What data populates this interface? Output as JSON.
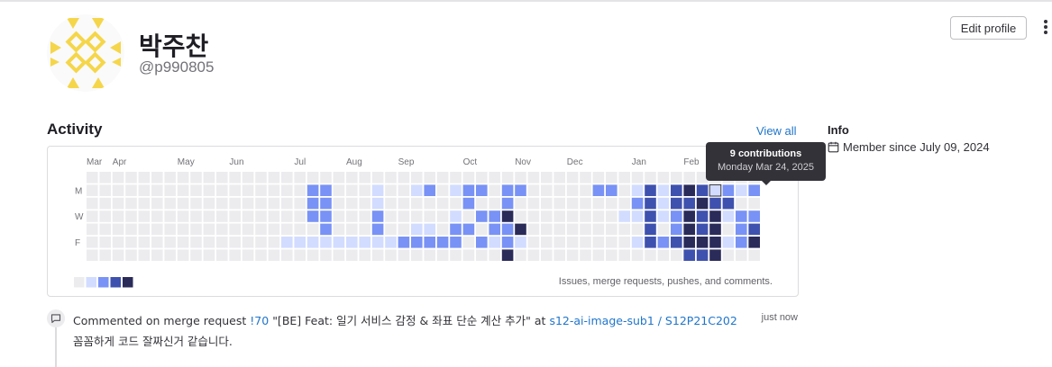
{
  "profile": {
    "name": "박주찬",
    "handle": "@p990805",
    "edit_label": "Edit profile",
    "avatar_color": "#f5d64a"
  },
  "activity": {
    "title": "Activity",
    "view_all": "View all",
    "months": [
      {
        "label": "Mar",
        "col": 0
      },
      {
        "label": "Apr",
        "col": 2
      },
      {
        "label": "May",
        "col": 7
      },
      {
        "label": "Jun",
        "col": 11
      },
      {
        "label": "Jul",
        "col": 16
      },
      {
        "label": "Aug",
        "col": 20
      },
      {
        "label": "Sep",
        "col": 24
      },
      {
        "label": "Oct",
        "col": 29
      },
      {
        "label": "Nov",
        "col": 33
      },
      {
        "label": "Dec",
        "col": 37
      },
      {
        "label": "Jan",
        "col": 42
      },
      {
        "label": "Feb",
        "col": 46
      }
    ],
    "day_labels": [
      {
        "label": "M",
        "row": 1
      },
      {
        "label": "W",
        "row": 3
      },
      {
        "label": "F",
        "row": 5
      }
    ],
    "levels": [
      "0000000000000000000000000000000000000000000000000000",
      "0000000000000000022000100120122022000002201313433212",
      "0000000000000000022000100000020020000000002313343300",
      "0000000000000000022000200000102240000000011312434122",
      "0000000000000000002000200110220224000000000302434023",
      "0000000000000001111111112222202121000000001323444124",
      "0000000000000000000000000000000040000000000000334000"
    ],
    "level_colors": [
      "#ececef",
      "#d2dcff",
      "#7992f5",
      "#3f51ae",
      "#2a2b59"
    ],
    "highlight": {
      "col": 48,
      "row": 1
    },
    "legend_text": "Issues, merge requests, pushes, and comments."
  },
  "tooltip": {
    "title": "9 contributions",
    "date": "Monday Mar 24, 2025"
  },
  "info": {
    "title": "Info",
    "member_since": "Member since July 09, 2024"
  },
  "event": {
    "action": "Commented on merge request",
    "mr_ref": "!70",
    "mr_title": "\"[BE] Feat: 일기 서비스 감정 & 좌표 단순 계산 추가\"",
    "at": "at",
    "project": "s12-ai-image-sub1 / S12P21C202",
    "time": "just now",
    "comment": "꼼꼼하게 코드 잘짜신거 같습니다."
  }
}
